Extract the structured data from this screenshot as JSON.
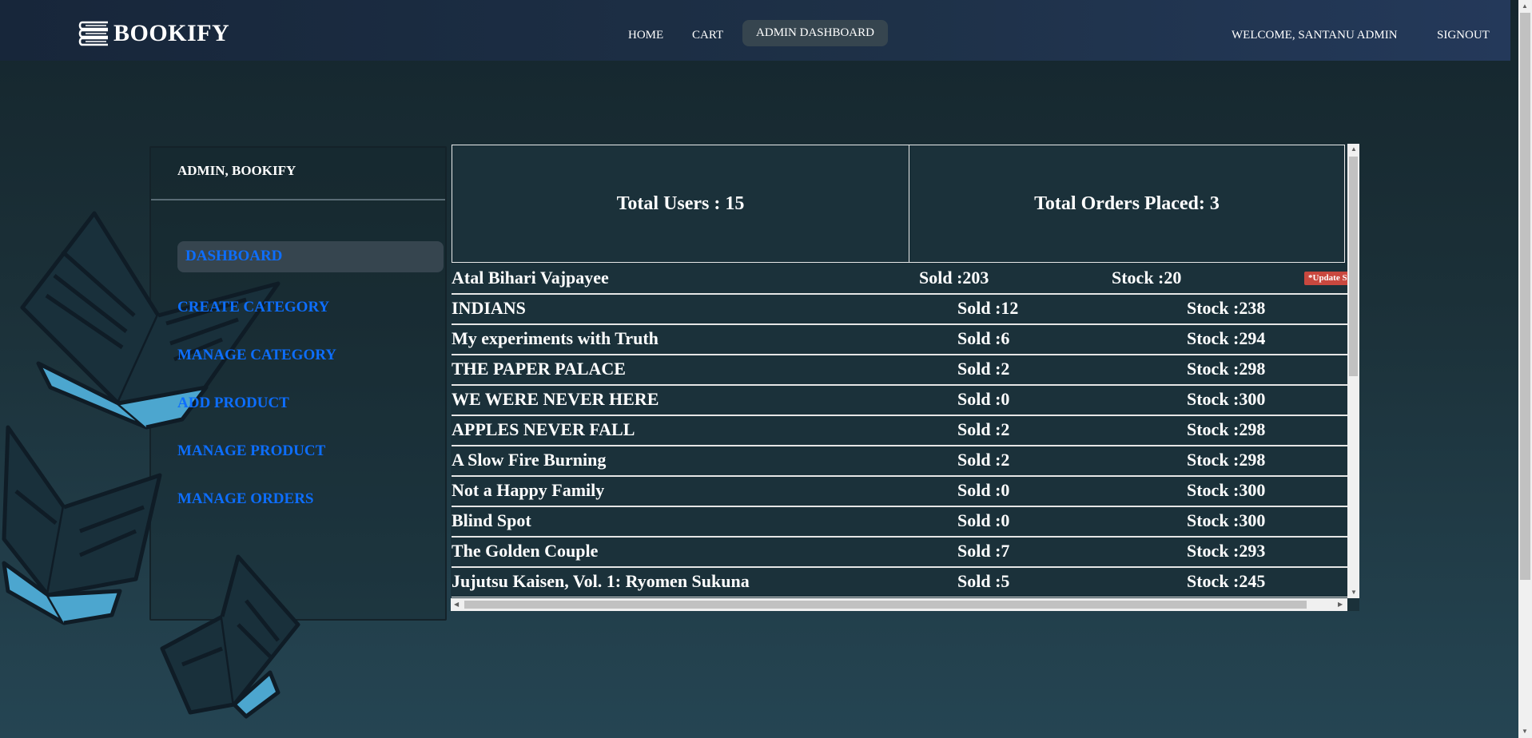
{
  "brand": {
    "name": "BOOKIFY",
    "logo_icon": "books-stack-icon"
  },
  "nav": {
    "home": "HOME",
    "cart": "CART",
    "admin_dashboard": "ADMIN DASHBOARD",
    "welcome": "WELCOME, SANTANU ADMIN",
    "signout": "SIGNOUT"
  },
  "sidebar": {
    "title": "ADMIN, BOOKIFY",
    "items": [
      {
        "label": "DASHBOARD",
        "active": true
      },
      {
        "label": "CREATE CATEGORY"
      },
      {
        "label": "MANAGE CATEGORY"
      },
      {
        "label": "ADD PRODUCT"
      },
      {
        "label": "MANAGE PRODUCT"
      },
      {
        "label": "MANAGE ORDERS"
      }
    ]
  },
  "stats": {
    "total_users": "Total Users : 15",
    "total_orders": "Total Orders Placed: 3"
  },
  "products": [
    {
      "name": "Atal Bihari Vajpayee",
      "sold": "Sold :203",
      "stock": "Stock :20",
      "badge": "*Update Stock"
    },
    {
      "name": "INDIANS",
      "sold": "Sold :12",
      "stock": "Stock :238"
    },
    {
      "name": "My experiments with Truth",
      "sold": "Sold :6",
      "stock": "Stock :294"
    },
    {
      "name": "THE PAPER PALACE",
      "sold": "Sold :2",
      "stock": "Stock :298"
    },
    {
      "name": "WE WERE NEVER HERE",
      "sold": "Sold :0",
      "stock": "Stock :300"
    },
    {
      "name": "APPLES NEVER FALL",
      "sold": "Sold :2",
      "stock": "Stock :298"
    },
    {
      "name": "A Slow Fire Burning",
      "sold": "Sold :2",
      "stock": "Stock :298"
    },
    {
      "name": "Not a Happy Family",
      "sold": "Sold :0",
      "stock": "Stock :300"
    },
    {
      "name": "Blind Spot",
      "sold": "Sold :0",
      "stock": "Stock :300"
    },
    {
      "name": "The Golden Couple",
      "sold": "Sold :7",
      "stock": "Stock :293"
    },
    {
      "name": "Jujutsu Kaisen, Vol. 1: Ryomen Sukuna",
      "sold": "Sold :5",
      "stock": "Stock :245"
    }
  ],
  "colors": {
    "link": "#0d6efd",
    "badge": "#c9483f",
    "pill": "#36454f"
  }
}
